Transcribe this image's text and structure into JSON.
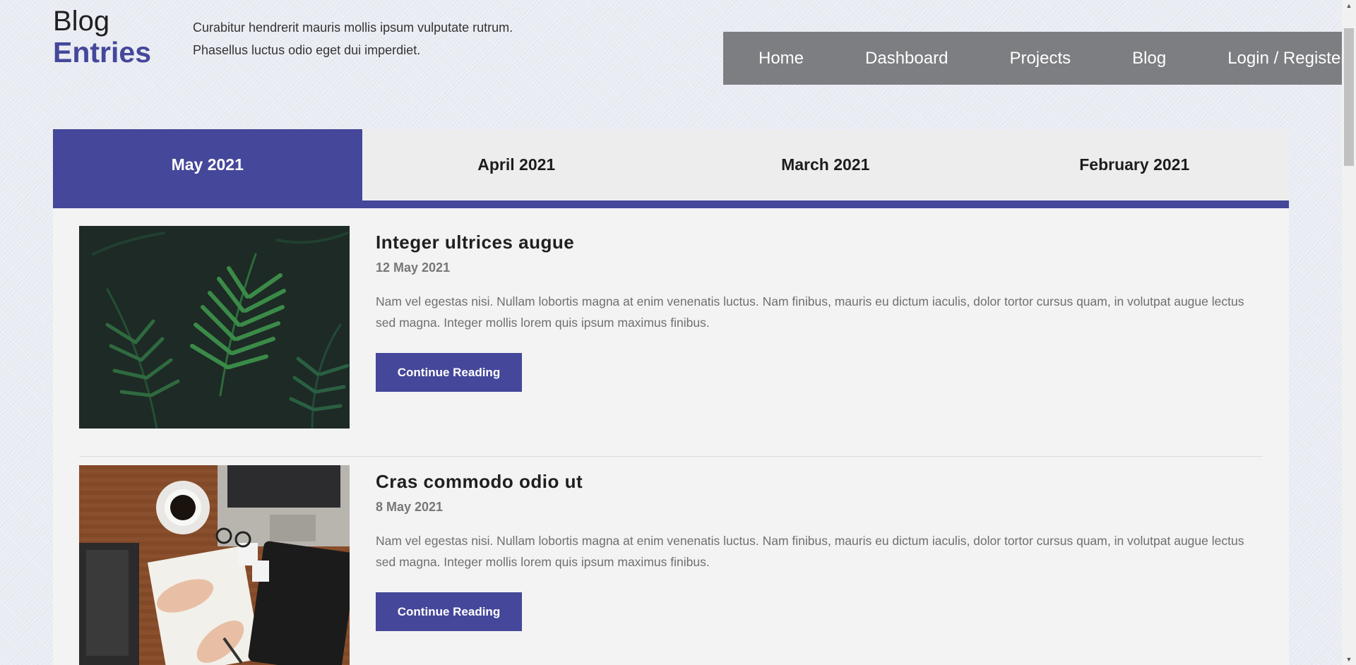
{
  "brand": {
    "line1": "Blog",
    "line2": "Entries"
  },
  "tagline": "Curabitur hendrerit mauris mollis ipsum vulputate rutrum. Phasellus luctus odio eget dui imperdiet.",
  "nav": {
    "items": [
      "Home",
      "Dashboard",
      "Projects",
      "Blog",
      "Login / Register"
    ]
  },
  "tabs": [
    "May 2021",
    "April 2021",
    "March 2021",
    "February 2021"
  ],
  "active_tab": "May 2021",
  "posts": [
    {
      "title": "Integer ultrices augue",
      "date": "12 May 2021",
      "excerpt": "Nam vel egestas nisi. Nullam lobortis magna at enim venenatis luctus. Nam finibus, mauris eu dictum iaculis, dolor tortor cursus quam, in volutpat augue lectus sed magna. Integer mollis lorem quis ipsum maximus finibus.",
      "button": "Continue Reading"
    },
    {
      "title": "Cras commodo odio ut",
      "date": "8 May 2021",
      "excerpt": "Nam vel egestas nisi. Nullam lobortis magna at enim venenatis luctus. Nam finibus, mauris eu dictum iaculis, dolor tortor cursus quam, in volutpat augue lectus sed magna. Integer mollis lorem quis ipsum maximus finibus.",
      "button": "Continue Reading"
    }
  ],
  "colors": {
    "accent": "#45479a",
    "nav_bg": "#7d7e82",
    "panel_bg": "#f3f3f4"
  },
  "icons": {
    "scroll_up": "triangle-up-icon",
    "scroll_down": "triangle-down-icon"
  }
}
